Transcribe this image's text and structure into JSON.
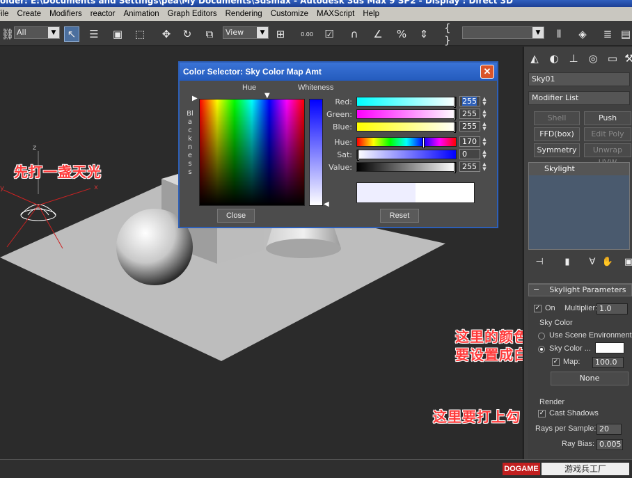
{
  "window": {
    "title": "older: E:\\Documents and Settings\\pea\\My Documents\\3dsmax  -  Autodesk 3ds Max 9 SP2  -  Display : Direct 3D"
  },
  "menu": [
    "File",
    "Create",
    "Modifiers",
    "reactor",
    "Animation",
    "Graph Editors",
    "Rendering",
    "Customize",
    "MAXScript",
    "Help"
  ],
  "toolbar": {
    "selection_filter": "All",
    "reference_coord": "View",
    "zoom_readout": "0.00"
  },
  "viewport": {
    "annotation_skylight": "先打一盏天光",
    "annotation_color": "这里的颜色\n要设置成白",
    "annotation_shadows": "这里要打上勾",
    "axis_z": "z",
    "axis_x": "x",
    "axis_y": "y"
  },
  "dialog": {
    "title": "Color Selector: Sky Color Map Amt",
    "hue_label": "Hue",
    "whiteness_label": "Whiteness",
    "blackness_label": "Blackness",
    "rows": [
      {
        "label": "Red:",
        "value": "255"
      },
      {
        "label": "Green:",
        "value": "255"
      },
      {
        "label": "Blue:",
        "value": "255"
      },
      {
        "label": "Hue:",
        "value": "170"
      },
      {
        "label": "Sat:",
        "value": "0"
      },
      {
        "label": "Value:",
        "value": "255"
      }
    ],
    "close_button": "Close",
    "reset_button": "Reset",
    "colors": {
      "swatch_old": "#eeeeff",
      "swatch_new": "#ffffff"
    }
  },
  "command_panel": {
    "object_name": "Sky01",
    "modifier_list": "Modifier List",
    "buttons": [
      "Shell",
      "Push",
      "FFD(box)",
      "Edit Poly",
      "Symmetry",
      "Unwrap UVW"
    ],
    "stack_item": "Skylight",
    "rollout": {
      "title": "Skylight Parameters",
      "on_label": "On",
      "multiplier_label": "Multiplier:",
      "multiplier_value": "1.0",
      "sky_color_group": "Sky Color",
      "use_scene_env": "Use Scene Environment",
      "sky_color_option": "Sky Color ...",
      "map_label": "Map:",
      "map_value": "100.0",
      "map_button": "None",
      "render_group": "Render",
      "cast_shadows": "Cast Shadows",
      "rays_label": "Rays per Sample:",
      "rays_value": "20",
      "ray_bias_label": "Ray Bias:",
      "ray_bias_value": "0.005"
    }
  },
  "watermark": {
    "logo": "DOGAME",
    "text": "游戏兵工厂"
  }
}
